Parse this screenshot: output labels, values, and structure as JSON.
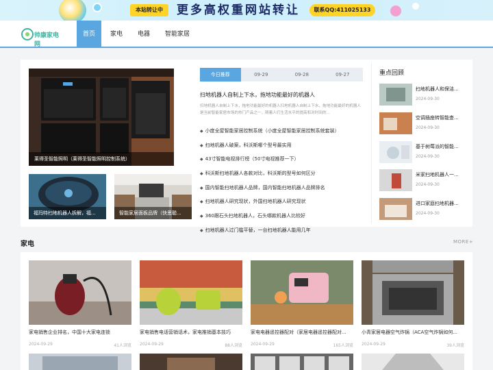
{
  "banner": {
    "label": "本站转让中",
    "headline": "更多高权重网站转让",
    "qq": "联系QQ:411025133"
  },
  "header": {
    "logo_text": "帅康家电网",
    "nav": [
      {
        "label": "首页",
        "active": true
      },
      {
        "label": "家电",
        "active": false
      },
      {
        "label": "电器",
        "active": false
      },
      {
        "label": "智能家居",
        "active": false
      }
    ]
  },
  "featured": {
    "hero_caption": "莱得圣智能照明（莱得圣智能照明控制系统）",
    "small": [
      {
        "caption": "福玛特扫地机器人拆解，福..."
      },
      {
        "caption": "智能家居面板品牌（快思聪..."
      }
    ]
  },
  "news": {
    "tabs": [
      {
        "label": "今日推荐",
        "active": true
      },
      {
        "label": "09-29",
        "active": false
      },
      {
        "label": "09-28",
        "active": false
      },
      {
        "label": "09-27",
        "active": false
      }
    ],
    "headline": "扫地机器人自制上下水，拖地功能最好的机器人",
    "summary": "扫地机器人自制上下水，拖地功能最好的机器人扫地机器人自制上下水，拖地功能最好的机器人是当前智能家居市场的热门产品之一，随着人们生活水平的提高和对时间的...",
    "items": [
      "小度全屋智能家居控制系统（小度全屋智能家居控制系统套装）",
      "扫地机器人破案，科沃斯哪个型号最实用",
      "43寸智能电视排行榜（50寸电视推荐一下）",
      "科沃斯扫地机器人各款对比，科沃斯的型号如何区分",
      "国内智能扫地机器人品牌，国内智能扫地机器人品牌排名",
      "扫地机器人研究现状，外国扫地机器人研究现状",
      "360跟石头扫地机器人，石头哪款机器人比较好",
      "扫地机器人过门槛平替，一台扫地机器人能用几年"
    ]
  },
  "sidebar": {
    "title": "重点回顾",
    "items": [
      {
        "title": "扫地机器人和保洁...",
        "date": "2024-09-30"
      },
      {
        "title": "空调插座转智能查...",
        "date": "2024-09-30"
      },
      {
        "title": "基于树莓派的智能...",
        "date": "2024-09-30"
      },
      {
        "title": "米家扫地机器人一...",
        "date": "2024-09-30"
      },
      {
        "title": "进口家庭扫地机器...",
        "date": "2024-09-30"
      }
    ]
  },
  "section": {
    "title": "家电",
    "more": "MORE+",
    "items": [
      {
        "title": "家电销售企业排名，中国十大家电连锁",
        "date": "2024-09-29",
        "views": "41人浏览"
      },
      {
        "title": "家电销售电话营销话术，家电推销基本技巧",
        "date": "2024-09-29",
        "views": "88人浏览"
      },
      {
        "title": "家电电器遥控器配对（家居电器遥控器配对...",
        "date": "2024-09-29",
        "views": "165人浏览"
      },
      {
        "title": "小青家居电器空气炸锅（ACA空气炸锅如何...",
        "date": "2024-09-29",
        "views": "39人浏览"
      }
    ]
  }
}
